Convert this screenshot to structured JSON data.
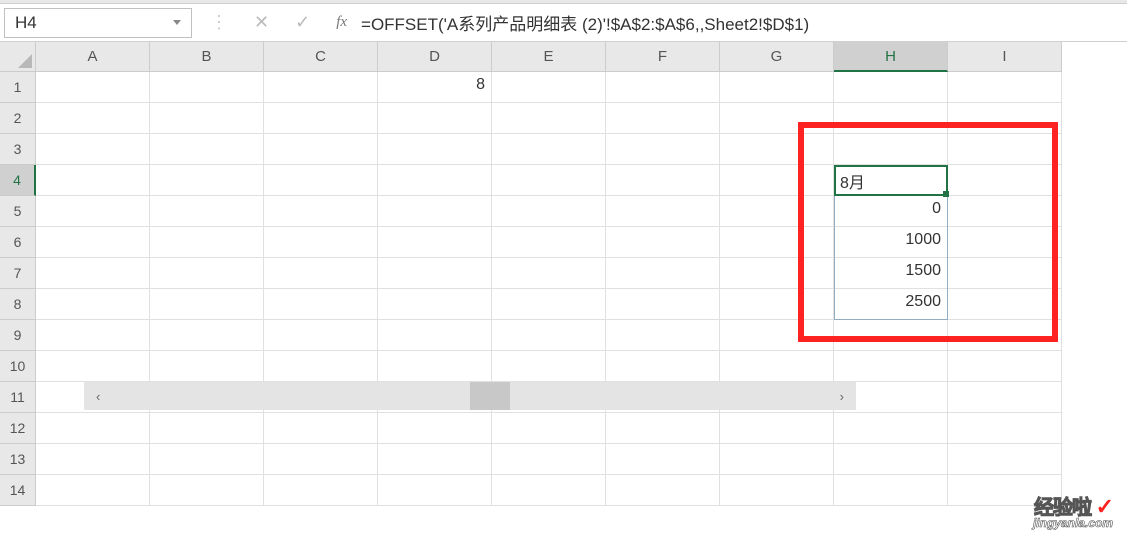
{
  "namebox": {
    "value": "H4"
  },
  "formula_bar": {
    "fx_label": "fx",
    "formula": "=OFFSET('A系列产品明细表 (2)'!$A$2:$A$6,,Sheet2!$D$1)"
  },
  "columns": [
    "A",
    "B",
    "C",
    "D",
    "E",
    "F",
    "G",
    "H",
    "I"
  ],
  "active_column_index": 7,
  "rows": [
    "1",
    "2",
    "3",
    "4",
    "5",
    "6",
    "7",
    "8",
    "9",
    "10",
    "11",
    "12",
    "13",
    "14"
  ],
  "active_row_index": 3,
  "cells": {
    "D1": "8",
    "H4": "8月",
    "H5": "0",
    "H6": "1000",
    "H7": "1500",
    "H8": "2500"
  },
  "watermark": {
    "line1a": "经验啦",
    "line1b": "✓",
    "line2": "jingyanla.com"
  }
}
